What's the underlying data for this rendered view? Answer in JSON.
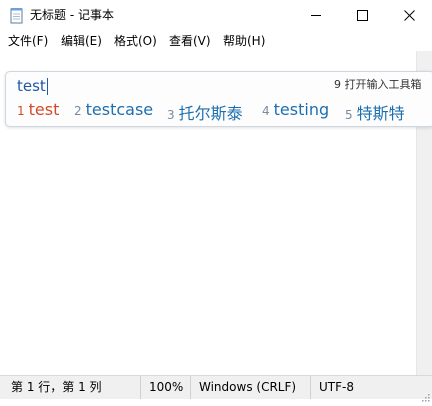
{
  "window": {
    "title": "无标题 - 记事本",
    "minimize": "minimize",
    "maximize": "maximize",
    "close": "close"
  },
  "menu": [
    {
      "label": "文件(F)"
    },
    {
      "label": "编辑(E)"
    },
    {
      "label": "格式(O)"
    },
    {
      "label": "查看(V)"
    },
    {
      "label": "帮助(H)"
    }
  ],
  "ime": {
    "composition": "test",
    "toolbox": "9 打开输入工具箱",
    "candidates": [
      {
        "num": "1",
        "text": "test"
      },
      {
        "num": "2",
        "text": "testcase"
      },
      {
        "num": "3",
        "text": "托尔斯泰"
      },
      {
        "num": "4",
        "text": "testing"
      },
      {
        "num": "5",
        "text": "特斯特"
      }
    ]
  },
  "status": {
    "position": "第 1 行，第 1 列",
    "zoom": "100%",
    "line_ending": "Windows (CRLF)",
    "encoding": "UTF-8"
  },
  "icons": {
    "app": "notepad-icon",
    "more": "chevron-left-icon"
  },
  "colors": {
    "selected_candidate": "#d34a2b",
    "candidate": "#1e6fb0",
    "composition": "#1e58a8"
  }
}
